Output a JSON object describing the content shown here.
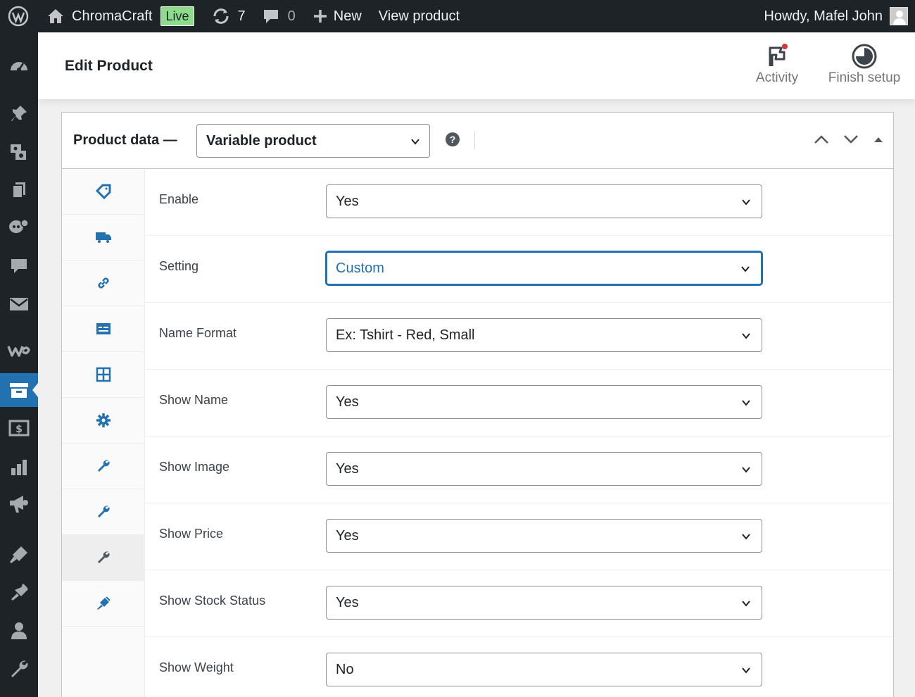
{
  "adminbar": {
    "site_name": "ChromaCraft",
    "live_badge": "Live",
    "updates_count": "7",
    "comments_count": "0",
    "new_label": "New",
    "view_product_label": "View product",
    "greeting": "Howdy, Mafel John"
  },
  "sidebar": {
    "items": [
      {
        "icon": "dashboard-icon"
      },
      {
        "icon": "posts-icon"
      },
      {
        "icon": "media-icon"
      },
      {
        "icon": "pages-icon"
      },
      {
        "icon": "feedback-icon"
      },
      {
        "icon": "comments-icon"
      },
      {
        "icon": "mail-icon"
      },
      {
        "icon": "woocommerce-icon"
      },
      {
        "icon": "products-icon",
        "active": true
      },
      {
        "icon": "payments-icon"
      },
      {
        "icon": "analytics-icon"
      },
      {
        "icon": "marketing-icon"
      },
      {
        "icon": "appearance-icon"
      },
      {
        "icon": "plugins-icon"
      },
      {
        "icon": "users-icon"
      },
      {
        "icon": "tools-icon"
      }
    ]
  },
  "header": {
    "title": "Edit Product",
    "activity_label": "Activity",
    "finish_setup_label": "Finish setup"
  },
  "product_data": {
    "label": "Product data —",
    "type_value": "Variable product",
    "tabs": [
      {
        "icon": "tag-icon"
      },
      {
        "icon": "truck-icon"
      },
      {
        "icon": "link-icon"
      },
      {
        "icon": "attributes-icon"
      },
      {
        "icon": "variations-grid-icon"
      },
      {
        "icon": "gear-icon"
      },
      {
        "icon": "wrench-icon"
      },
      {
        "icon": "wrench-icon"
      },
      {
        "icon": "wrench-icon",
        "active": true
      },
      {
        "icon": "plug-icon"
      }
    ],
    "fields": [
      {
        "label": "Enable",
        "value": "Yes"
      },
      {
        "label": "Setting",
        "value": "Custom"
      },
      {
        "label": "Name Format",
        "value": "Ex: Tshirt - Red, Small"
      },
      {
        "label": "Show Name",
        "value": "Yes"
      },
      {
        "label": "Show Image",
        "value": "Yes"
      },
      {
        "label": "Show Price",
        "value": "Yes"
      },
      {
        "label": "Show Stock Status",
        "value": "Yes"
      },
      {
        "label": "Show Weight",
        "value": "No"
      }
    ]
  },
  "colors": {
    "admin_bar": "#1d2327",
    "accent": "#2271b1",
    "live_badge": "#8cdc8c"
  }
}
